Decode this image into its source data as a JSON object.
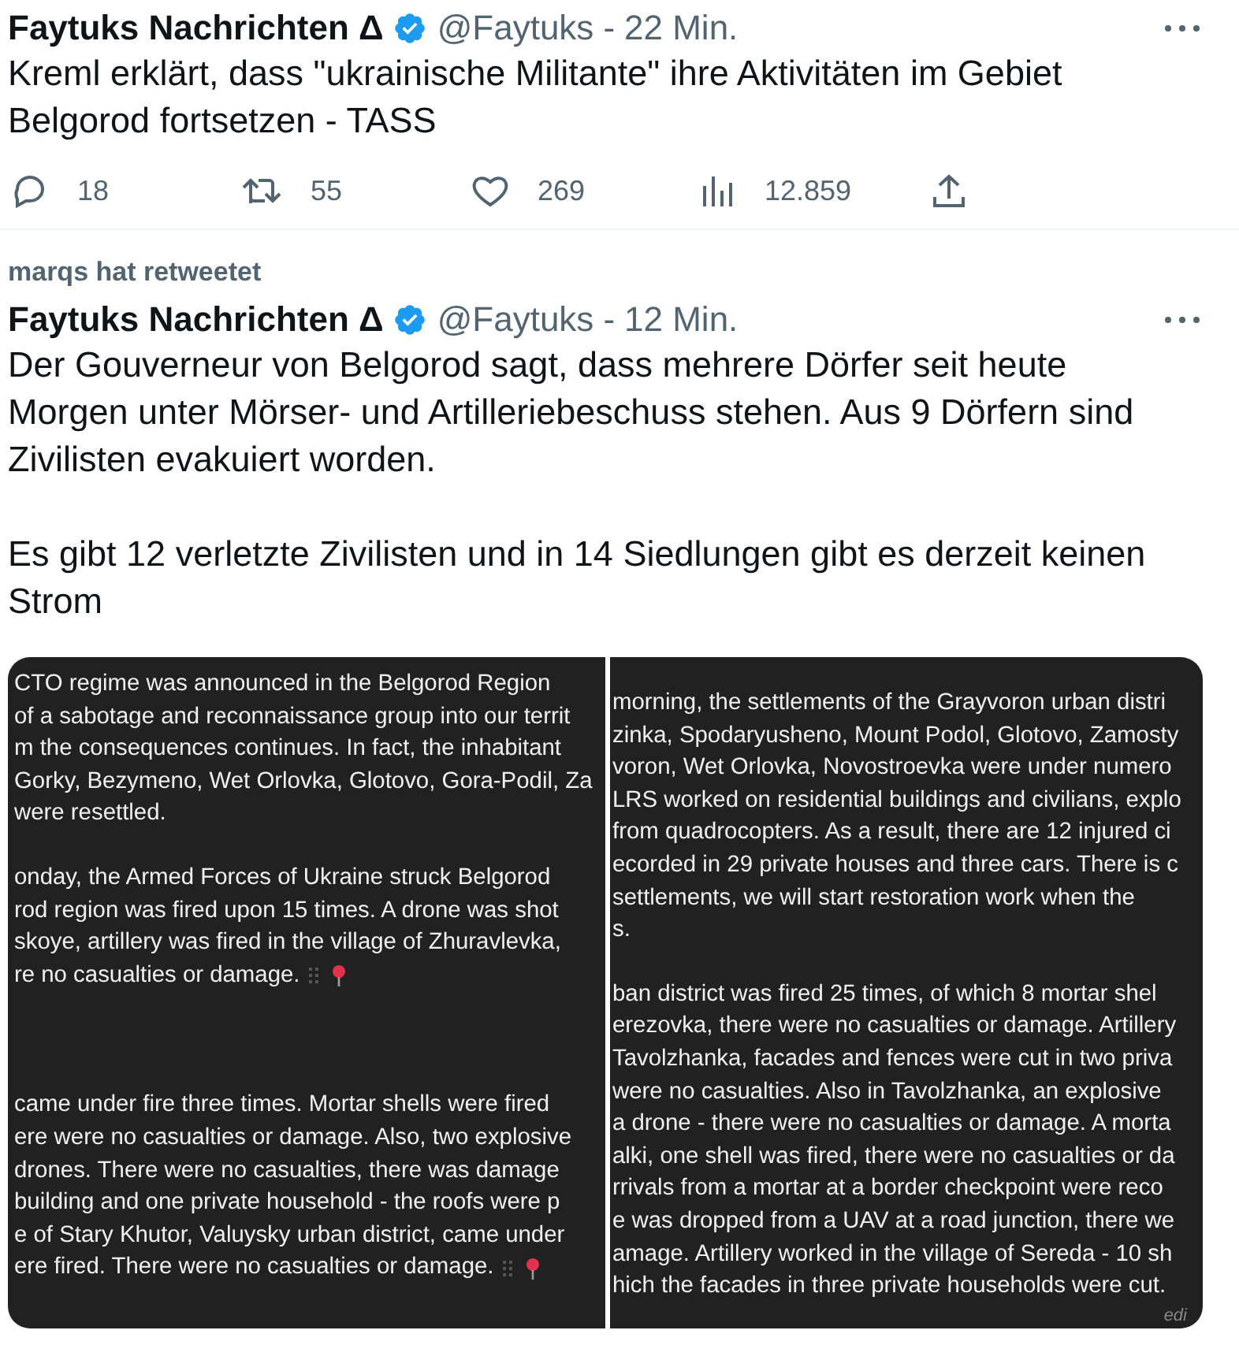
{
  "tweets": [
    {
      "author": "Faytuks Nachrichten Δ",
      "verified": true,
      "handle": "@Faytuks",
      "separator": "-",
      "time": "22 Min.",
      "paragraphs": [
        "Kreml erklärt, dass \"ukrainische Militante\" ihre Aktivitäten im Gebiet Belgorod fortsetzen - TASS"
      ],
      "actions": [
        {
          "kind": "reply",
          "count": "18"
        },
        {
          "kind": "retweet",
          "count": "55"
        },
        {
          "kind": "like",
          "count": "269"
        },
        {
          "kind": "views",
          "count": "12.859"
        },
        {
          "kind": "share"
        }
      ]
    },
    {
      "retweeted_by": "marqs hat retweetet",
      "author": "Faytuks Nachrichten Δ",
      "verified": true,
      "handle": "@Faytuks",
      "separator": "-",
      "time": "12 Min.",
      "paragraphs": [
        "Der Gouverneur von Belgorod sagt, dass mehrere Dörfer seit heute Morgen unter Mörser- und Artilleriebeschuss stehen. Aus 9 Dörfern sind Zivilisten evakuiert worden.",
        "Es gibt 12 verletzte Zivilisten und in 14 Siedlungen gibt es derzeit keinen Strom"
      ],
      "images": [
        {
          "paragraphs": [
            {
              "lines": [
                "CTO regime was announced in the Belgorod Region",
                "of a sabotage and reconnaissance group into our territ",
                "m the consequences continues. In fact, the inhabitant",
                "Gorky, Bezymeno, Wet Orlovka, Glotovo, Gora-Podil, Za",
                "were resettled."
              ],
              "pin": false
            },
            {
              "lines": [
                "onday, the Armed Forces of Ukraine struck Belgorod",
                "rod region was fired upon 15 times. A drone was shot",
                "skoye, artillery was fired in the village of Zhuravlevka,",
                "re no casualties or damage."
              ],
              "pin": true
            },
            {
              "lines": [
                "came under fire three times. Mortar shells were fired",
                "ere were no casualties or damage. Also, two explosive",
                "drones. There were no casualties, there was damage",
                "building and one private household - the roofs were p",
                "e of Stary Khutor, Valuysky urban district, came under",
                "ere fired. There were no casualties or damage."
              ],
              "pin": true
            }
          ]
        },
        {
          "paragraphs": [
            {
              "lines": [
                "morning, the settlements of the Grayvoron urban distri",
                "zinka, Spodaryusheno, Mount Podol, Glotovo, Zamosty",
                "voron, Wet Orlovka, Novostroevka were under numero",
                "LRS worked on residential buildings and civilians, explo",
                "from quadrocopters. As a result, there are 12 injured ci",
                "ecorded in 29 private houses and three cars. There is c",
                "settlements, we will start restoration work when the",
                "s."
              ],
              "pin": false
            },
            {
              "lines": [
                "ban district was fired 25 times, of which 8 mortar shel",
                "erezovka, there were no casualties or damage. Artillery",
                "Tavolzhanka, facades and fences were cut in two priva",
                "were no casualties. Also in Tavolzhanka, an explosive",
                "a drone - there were no casualties or damage. A morta",
                "alki, one shell was fired, there were no casualties or da",
                "rrivals from a mortar at a border checkpoint were reco",
                "e was dropped from a UAV at a road junction, there we",
                "amage. Artillery worked in the village of Sereda - 10 sh",
                "hich the facades in three private households were cut."
              ],
              "pin": false
            }
          ],
          "footer": "edi"
        }
      ]
    }
  ]
}
